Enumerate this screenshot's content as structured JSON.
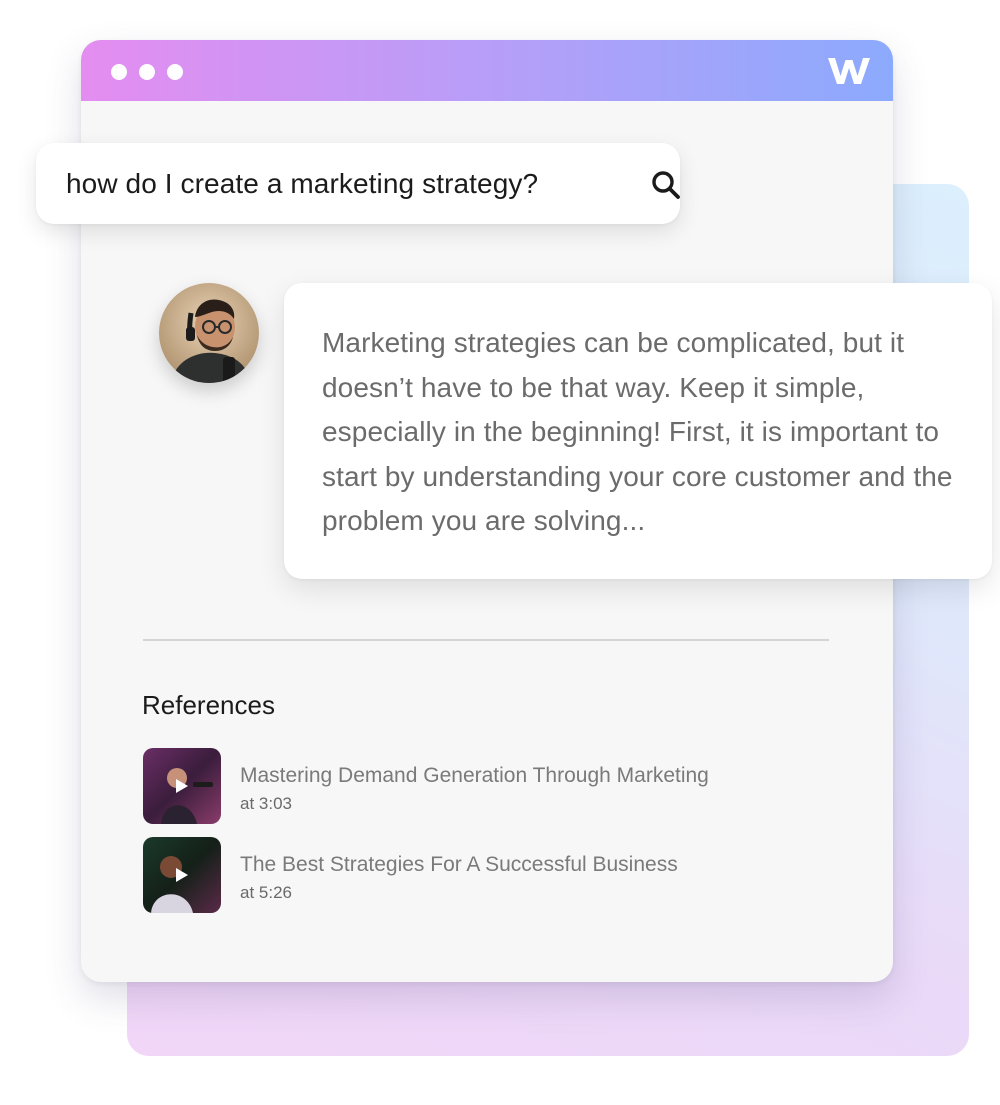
{
  "search": {
    "query": "how do I create a marketing strategy?",
    "icon": "search-icon"
  },
  "logo": {
    "icon": "w-logo-icon"
  },
  "answer": {
    "text": "Marketing strategies can be complicated, but it doesn’t have to be that way. Keep it simple, especially in the beginning! First, it is important to start by understanding your core customer and the problem you are solving..."
  },
  "references": {
    "heading": "References",
    "items": [
      {
        "title": "Mastering Demand Generation Through Marketing",
        "time": "at 3:03",
        "icon": "play-icon"
      },
      {
        "title": "The Best Strategies For A Successful Business",
        "time": "at 5:26",
        "icon": "play-icon"
      }
    ]
  },
  "colors": {
    "titlebar_start": "#e48df0",
    "titlebar_end": "#8caafd",
    "window_bg": "#f7f7f7",
    "text_dark": "#1b1b1b",
    "text_muted": "#6b6b6b"
  }
}
